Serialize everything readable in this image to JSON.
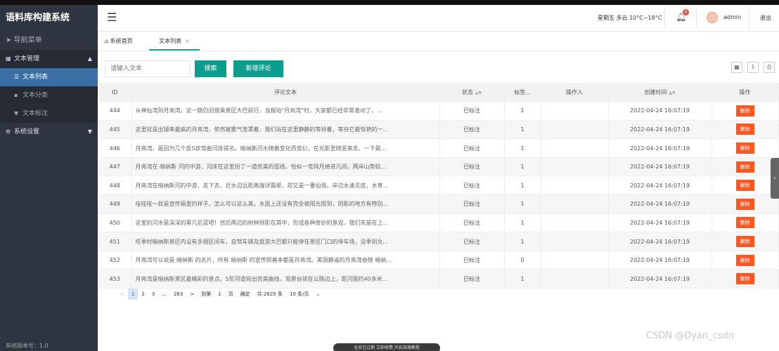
{
  "app": {
    "title": "语料库构建系统",
    "version_text": "系统版本号：1.0"
  },
  "sidebar": {
    "nav_header": "导航菜单",
    "groups": [
      {
        "label": "文本管理",
        "children": [
          "文本列表",
          "文本分类",
          "文本标注"
        ]
      },
      {
        "label": "系统设置"
      }
    ]
  },
  "header": {
    "weather": "星期五 多云 10°C~18°C",
    "bell_count": "0",
    "username": "admin",
    "logout_label": "退出"
  },
  "tabs": {
    "home": "系统首页",
    "current": "文本列表"
  },
  "toolbar": {
    "search_placeholder": "请输入文本",
    "search_label": "搜索",
    "add_label": "新增评论"
  },
  "table": {
    "columns": [
      "ID",
      "评论文本",
      "状态",
      "标签...",
      "操作人",
      "创建时间",
      "操作"
    ],
    "delete_label": "删除",
    "rows": [
      {
        "id": "444",
        "text": "从神仙湾到月亮湾，这一路仍旧搭乘景区大巴前行，当报站\"月亮湾\"时，大家都已经非常激动了，…",
        "status": "已标注",
        "label": "1",
        "operator": "",
        "time": "2022-04-24 16:07:19"
      },
      {
        "id": "445",
        "text": "这里就是出镜率最高的月亮湾，依然被雾气笼罩着，我们站在这里静静的等待着，等待它最惊艳的一…",
        "status": "已标注",
        "label": "1",
        "operator": "",
        "time": "2022-04-24 16:07:19"
      },
      {
        "id": "446",
        "text": "月亮湾，是因为几个反S状弯曲河床得名。暗纳斯河水随着变化而变幻，在光影里随意来去，一下是…",
        "status": "已标注",
        "label": "1",
        "operator": "",
        "time": "2022-04-24 16:07:19"
      },
      {
        "id": "447",
        "text": "月亮湾在 暗纳斯 河的中游，河床在这里拐了一道优美的弧线，恰似一弯钩月掉进凡间。两岸山势较…",
        "status": "已标注",
        "label": "1",
        "operator": "",
        "time": "2022-04-24 16:07:19"
      },
      {
        "id": "448",
        "text": "月亮湾在暗纳斯河的中游，走下去，近水边远距离端详翡翠，却又是一番仙境。岸边水清见底，水草…",
        "status": "已标注",
        "label": "1",
        "operator": "",
        "time": "2022-04-24 16:07:19"
      },
      {
        "id": "449",
        "text": "哇哇哇～就是宣传画里的样子，怎么可以这么美。水面上还没有完全被阳光照到，阴影的地方有特别…",
        "status": "已标注",
        "label": "1",
        "operator": "",
        "time": "2022-04-24 16:07:19"
      },
      {
        "id": "450",
        "text": "这里的河水是深深的蒂凡尼蓝吧！然后两边的树林倒影在其中，形成各种奇妙的景观，我们先是在上…",
        "status": "已标注",
        "label": "1",
        "operator": "",
        "time": "2022-04-24 16:07:19"
      },
      {
        "id": "451",
        "text": "旺季时暗纳斯景区内设有多個区间车，自驾车辆及旅游大巴都只能停在景区门口的停车场，没季则允…",
        "status": "已标注",
        "label": "1",
        "operator": "",
        "time": "2022-04-24 16:07:19"
      },
      {
        "id": "452",
        "text": "月亮湾可以说是 暗纳斯 的名片，所有 暗纳斯 的宣传照基本都是月亮湾。美丽静谧的月亮湾会随 暗纳…",
        "status": "已标注",
        "label": "0",
        "operator": "",
        "time": "2022-04-24 16:07:19"
      },
      {
        "id": "453",
        "text": "月亮湾是暗纳斯景区最精彩的景点。S形河道宛出优美曲线，观景台就在公路边上，距河面约40多米…",
        "status": "已标注",
        "label": "1",
        "operator": "",
        "time": "2022-04-24 16:07:19"
      }
    ]
  },
  "pagination": {
    "pages": [
      "1",
      "2",
      "3",
      "...",
      "263"
    ],
    "next": ">",
    "goto_prefix": "到第",
    "goto_value": "1",
    "goto_suffix": "页",
    "confirm": "确定",
    "total": "共 2625 条",
    "per_page": "10 条/页"
  },
  "overlay": {
    "notice": "全员已过期 立即续费 开启加速教程",
    "watermark": "CSDN @Dyan_csdn"
  }
}
